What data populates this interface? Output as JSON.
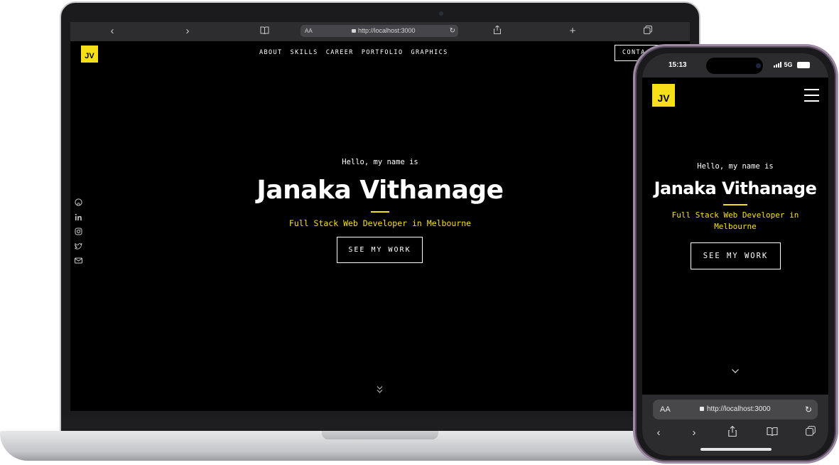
{
  "browser": {
    "url": "http://localhost:3000",
    "reader_label": "AA",
    "phone_reader_label": "AA"
  },
  "site": {
    "logo": "JV",
    "nav": [
      "ABOUT",
      "SKILLS",
      "CAREER",
      "PORTFOLIO",
      "GRAPHICS"
    ],
    "contact_label": "CONTA",
    "greeting": "Hello, my name is",
    "name": "Janaka Vithanage",
    "tagline": "Full Stack Web Developer in Melbourne",
    "cta": "SEE MY WORK",
    "social_icons": [
      "github-icon",
      "linkedin-icon",
      "instagram-icon",
      "twitter-icon",
      "mail-icon"
    ]
  },
  "phone": {
    "time": "15:13",
    "network": "5G"
  },
  "colors": {
    "accent": "#f7e018",
    "background": "#000000",
    "text": "#ffffff"
  }
}
